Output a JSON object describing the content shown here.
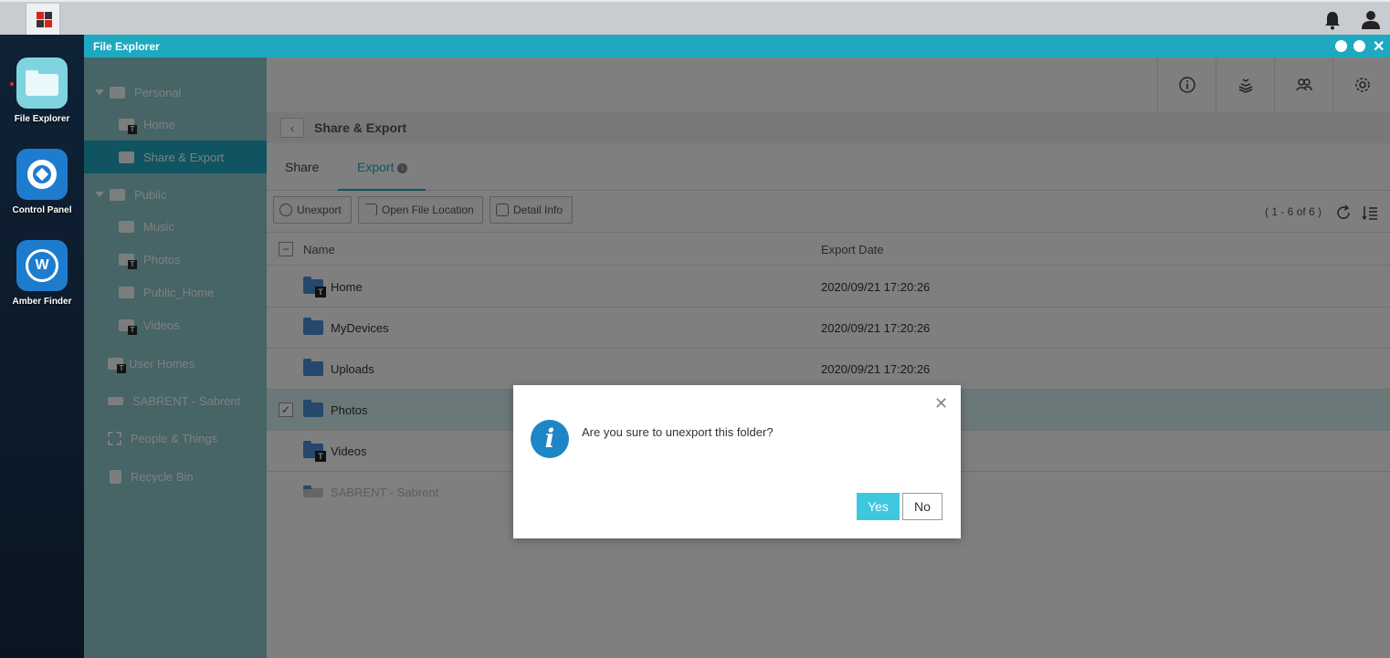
{
  "desktop": {
    "apps": [
      {
        "label": "File Explorer",
        "icon": "folder-icon"
      },
      {
        "label": "Control Panel",
        "icon": "gear-icon"
      },
      {
        "label": "Amber Finder",
        "icon": "finder-icon"
      }
    ]
  },
  "window": {
    "title": "File Explorer"
  },
  "sidebar": {
    "items": [
      {
        "label": "Personal",
        "icon": "home-folder-icon"
      },
      {
        "label": "Home",
        "icon": "folder-t-icon"
      },
      {
        "label": "Share & Export",
        "icon": "share-icon"
      },
      {
        "label": "Public",
        "icon": "public-folder-icon"
      },
      {
        "label": "Music",
        "icon": "folder-icon"
      },
      {
        "label": "Photos",
        "icon": "folder-t-icon"
      },
      {
        "label": "Public_Home",
        "icon": "folder-icon"
      },
      {
        "label": "Videos",
        "icon": "folder-t-icon"
      },
      {
        "label": "User Homes",
        "icon": "folder-t-icon"
      },
      {
        "label": "SABRENT - Sabrent",
        "icon": "drive-icon"
      },
      {
        "label": "People & Things",
        "icon": "face-icon"
      },
      {
        "label": "Recycle Bin",
        "icon": "trash-icon"
      }
    ]
  },
  "breadcrumb": {
    "title": "Share & Export"
  },
  "tabs": [
    {
      "label": "Share"
    },
    {
      "label": "Export"
    }
  ],
  "toolbar": {
    "unexport": "Unexport",
    "open_location": "Open File Location",
    "detail_info": "Detail Info",
    "count": "( 1 - 6 of 6 )"
  },
  "table": {
    "headers": {
      "name": "Name",
      "date": "Export Date"
    },
    "rows": [
      {
        "name": "Home",
        "date": "2020/09/21 17:20:26",
        "badge": "T"
      },
      {
        "name": "MyDevices",
        "date": "2020/09/21 17:20:26",
        "badge": ""
      },
      {
        "name": "Uploads",
        "date": "2020/09/21 17:20:26",
        "badge": ""
      },
      {
        "name": "Photos",
        "date": "",
        "badge": ""
      },
      {
        "name": "Videos",
        "date": "",
        "badge": "T"
      },
      {
        "name": "SABRENT - Sabrent",
        "date": "",
        "badge": ""
      }
    ]
  },
  "dialog": {
    "message": "Are you sure to unexport this folder?",
    "yes": "Yes",
    "no": "No",
    "icon_letter": "i"
  },
  "colors": {
    "accent": "#1ea9c0",
    "sidebar": "#8fc8cf",
    "yes_button": "#3ec8de"
  }
}
